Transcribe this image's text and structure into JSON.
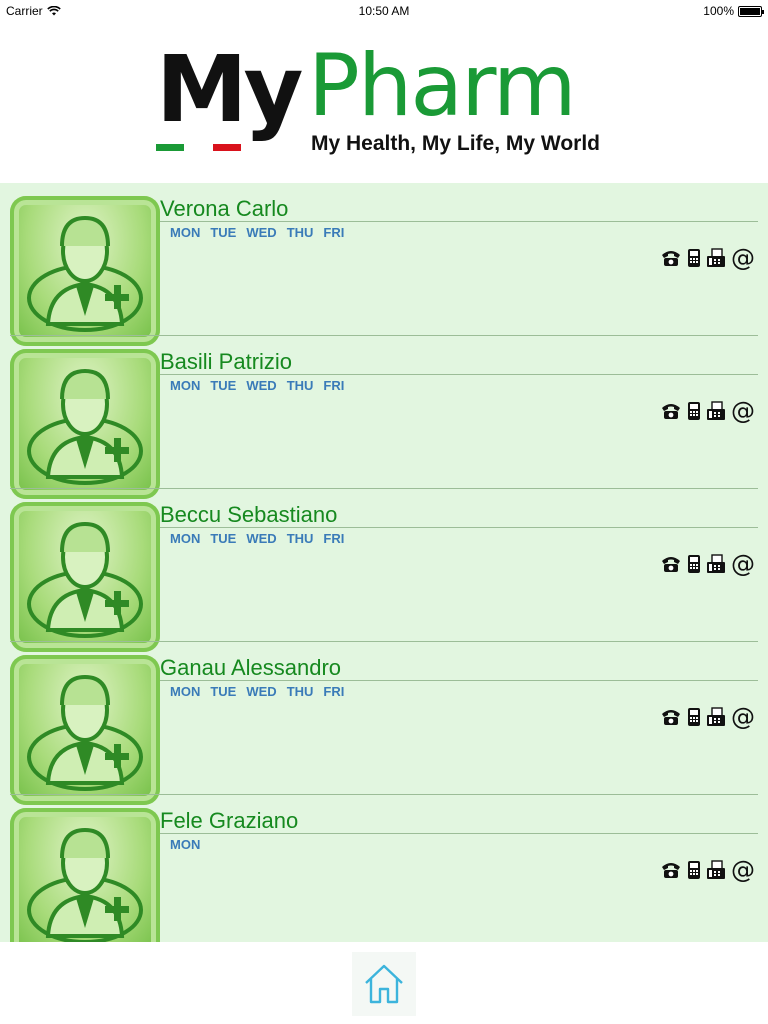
{
  "status": {
    "carrier": "Carrier",
    "time": "10:50 AM",
    "battery": "100%"
  },
  "logo": {
    "my": "My",
    "pharm": "Pharm",
    "tagline": "My Health, My Life, My World"
  },
  "colors": {
    "brand_green": "#1a9a36",
    "list_bg": "#e2f6e0",
    "day_blue": "#3a7bb8",
    "name_green": "#16891f"
  },
  "doctors": [
    {
      "name": "Verona Carlo",
      "days": [
        "MON",
        "TUE",
        "WED",
        "THU",
        "FRI"
      ]
    },
    {
      "name": "Basili Patrizio",
      "days": [
        "MON",
        "TUE",
        "WED",
        "THU",
        "FRI"
      ]
    },
    {
      "name": "Beccu Sebastiano",
      "days": [
        "MON",
        "TUE",
        "WED",
        "THU",
        "FRI"
      ]
    },
    {
      "name": "Ganau Alessandro",
      "days": [
        "MON",
        "TUE",
        "WED",
        "THU",
        "FRI"
      ]
    },
    {
      "name": "Fele Graziano",
      "days": [
        "MON"
      ]
    }
  ],
  "contact_icons": [
    "phone-icon",
    "mobile-icon",
    "fax-icon",
    "email-icon"
  ],
  "footer": {
    "icon": "home-icon"
  }
}
